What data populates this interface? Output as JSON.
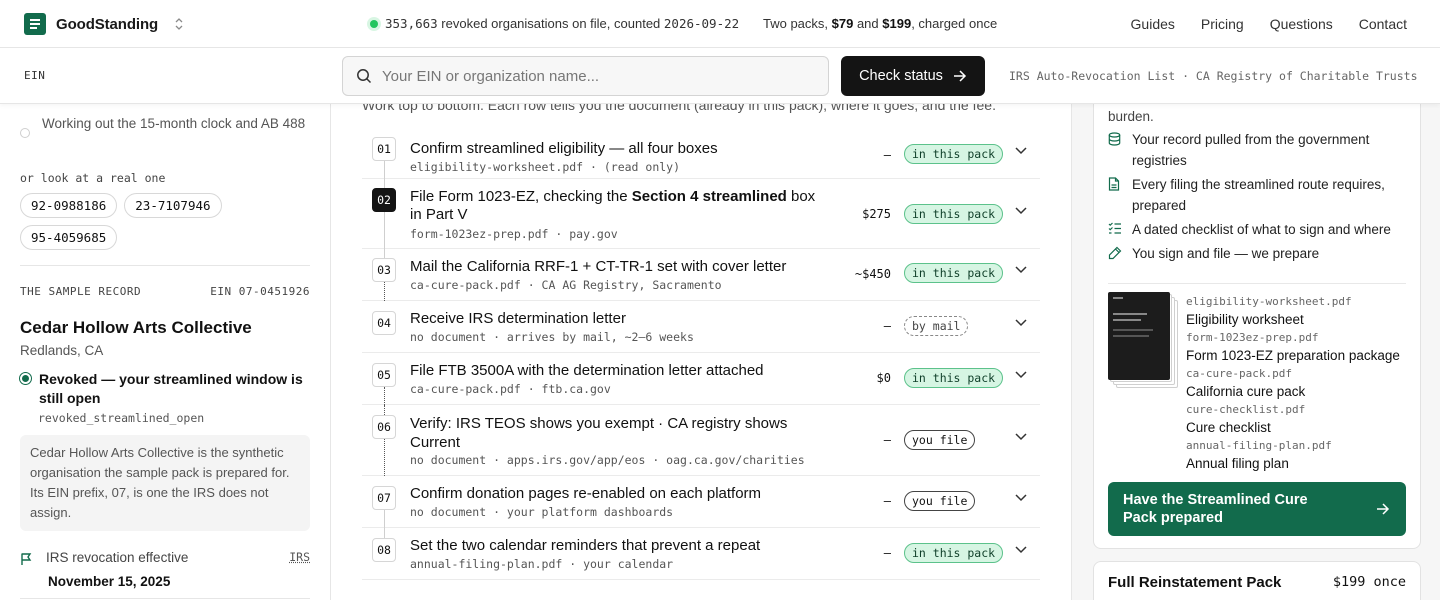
{
  "header": {
    "brand": "GoodStanding",
    "status_count": "353,663",
    "status_text": " revoked organisations on file, counted ",
    "status_date": "2026-09-22",
    "packs_prefix": "Two packs, ",
    "packs_price1": "$79",
    "packs_and": " and ",
    "packs_price2": "$199",
    "packs_suffix": ", charged once",
    "nav": [
      "Guides",
      "Pricing",
      "Questions",
      "Contact"
    ]
  },
  "search": {
    "tag": "EIN",
    "placeholder": "Your EIN or organization name...",
    "button": "Check status",
    "sources": "IRS Auto-Revocation List · CA Registry of Charitable Trusts"
  },
  "sidebar": {
    "step_text": "Working out the 15-month clock and AB 488",
    "look_label": "or look at a real one",
    "chips": [
      "92-0988186",
      "23-7107946",
      "95-4059685"
    ],
    "sample_label": "THE SAMPLE RECORD",
    "sample_ein": "EIN 07-0451926",
    "org_name": "Cedar Hollow Arts Collective",
    "org_location": "Redlands, CA",
    "status": "Revoked — your streamlined window is still open",
    "status_code": "revoked_streamlined_open",
    "note": "Cedar Hollow Arts Collective is the synthetic organisation the sample pack is prepared for. Its EIN prefix, 07, is one the IRS does not assign.",
    "irs_label": "IRS revocation effective",
    "irs_tag": "IRS",
    "irs_date": "November 15, 2025"
  },
  "main": {
    "intro": "Work top to bottom. Each row tells you the document (already in this pack), where it goes, and the fee.",
    "rows": [
      {
        "num": "01",
        "title": "Confirm streamlined eligibility — all four boxes",
        "sub": "eligibility-worksheet.pdf · (read only)",
        "fee": "–",
        "badge": "in this pack"
      },
      {
        "num": "02",
        "title_a": "File Form 1023-EZ, checking the ",
        "title_b": "Section 4 streamlined",
        "title_c": " box in Part V",
        "sub": "form-1023ez-prep.pdf · pay.gov",
        "fee": "$275",
        "badge": "in this pack"
      },
      {
        "num": "03",
        "title": "Mail the California RRF-1 + CT-TR-1 set with cover letter",
        "sub": "ca-cure-pack.pdf · CA AG Registry, Sacramento",
        "fee": "~$450",
        "badge": "in this pack"
      },
      {
        "num": "04",
        "title": "Receive IRS determination letter",
        "sub": "no document · arrives by mail, ~2–6 weeks",
        "fee": "–",
        "badge": "by mail"
      },
      {
        "num": "05",
        "title": "File FTB 3500A with the determination letter attached",
        "sub": "ca-cure-pack.pdf · ftb.ca.gov",
        "fee": "$0",
        "badge": "in this pack"
      },
      {
        "num": "06",
        "title": "Verify: IRS TEOS shows you exempt · CA registry shows Current",
        "sub": "no document · apps.irs.gov/app/eos · oag.ca.gov/charities",
        "fee": "–",
        "badge": "you file"
      },
      {
        "num": "07",
        "title": "Confirm donation pages re-enabled on each platform",
        "sub": "no document · your platform dashboards",
        "fee": "–",
        "badge": "you file"
      },
      {
        "num": "08",
        "title": "Set the two calendar reminders that prevent a repeat",
        "sub": "annual-filing-plan.pdf · your calendar",
        "fee": "–",
        "badge": "in this pack"
      }
    ]
  },
  "pack": {
    "burden": "burden.",
    "features": [
      {
        "icon": "database-icon",
        "text": "Your record pulled from the government registries"
      },
      {
        "icon": "document-icon",
        "text": "Every filing the streamlined route requires, prepared"
      },
      {
        "icon": "checklist-icon",
        "text": "A dated checklist of what to sign and where"
      },
      {
        "icon": "pen-icon",
        "text": "You sign and file — we prepare"
      }
    ],
    "documents": [
      {
        "file": "eligibility-worksheet.pdf",
        "name": "Eligibility worksheet"
      },
      {
        "file": "form-1023ez-prep.pdf",
        "name": "Form 1023-EZ preparation package"
      },
      {
        "file": "ca-cure-pack.pdf",
        "name": "California cure pack"
      },
      {
        "file": "cure-checklist.pdf",
        "name": "Cure checklist"
      },
      {
        "file": "annual-filing-plan.pdf",
        "name": "Annual filing plan"
      }
    ],
    "cta": "Have the Streamlined Cure Pack prepared",
    "full_title": "Full Reinstatement Pack",
    "full_price": "$199 once"
  },
  "colors": {
    "brand": "#126b4c",
    "badge_bg": "#d6f5e3",
    "status_dot": "#22c55e"
  }
}
